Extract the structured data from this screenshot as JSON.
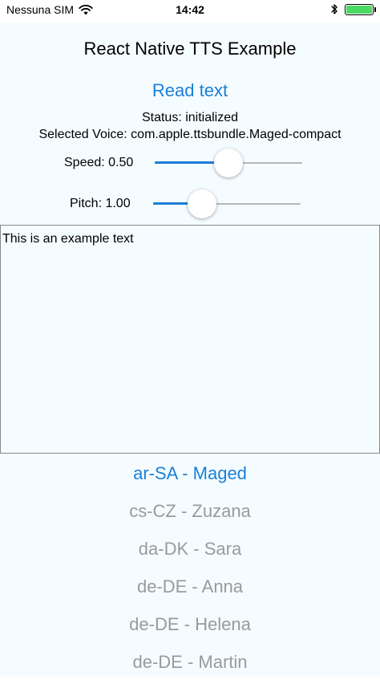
{
  "status_bar": {
    "carrier": "Nessuna SIM",
    "time": "14:42",
    "battery_level": 1.0,
    "battery_color": "#4cd964"
  },
  "app": {
    "title": "React Native TTS Example",
    "read_button_label": "Read text",
    "status_text": "Status: initialized",
    "selected_voice_text": "Selected Voice: com.apple.ttsbundle.Maged-compact",
    "accent_color": "#1a7fd8",
    "speed": {
      "label": "Speed: 0.50",
      "value": 0.5,
      "min": 0,
      "max": 1
    },
    "pitch": {
      "label": "Pitch: 1.00",
      "value": 1.0,
      "min": 0.5,
      "max": 2
    },
    "text_input_value": "This is an example text",
    "voices": [
      {
        "label": "ar-SA - Maged",
        "selected": true
      },
      {
        "label": "cs-CZ - Zuzana",
        "selected": false
      },
      {
        "label": "da-DK - Sara",
        "selected": false
      },
      {
        "label": "de-DE - Anna",
        "selected": false
      },
      {
        "label": "de-DE - Helena",
        "selected": false
      },
      {
        "label": "de-DE - Martin",
        "selected": false
      }
    ]
  }
}
